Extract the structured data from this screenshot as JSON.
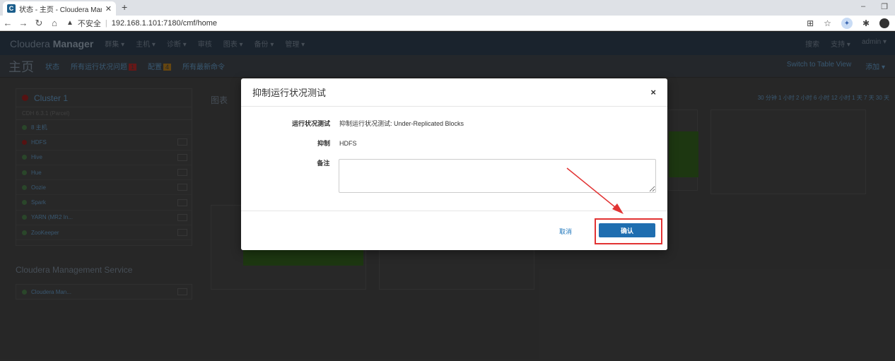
{
  "browser": {
    "tab_title": "状态 - 主页 - Cloudera Manage",
    "tab_favicon": "C",
    "url_warning": "不安全",
    "url": "192.168.1.101:7180/cmf/home"
  },
  "app": {
    "brand_light": "Cloudera",
    "brand_bold": "Manager",
    "nav_items": [
      "群集 ▾",
      "主机 ▾",
      "诊断 ▾",
      "审核",
      "图表 ▾",
      "备份 ▾",
      "管理 ▾"
    ],
    "nav_right": [
      "搜索",
      "支持 ▾",
      "admin ▾"
    ],
    "page_title": "主页",
    "subtabs": [
      "状态",
      "所有运行状况问题",
      "配置",
      "所有最新命令"
    ],
    "health_badge": "1",
    "config_badge": "4",
    "subbar_right": [
      "Switch to Table View",
      "添加 ▾"
    ],
    "cluster_name": "Cluster 1",
    "cdh_version": "CDH 6.3.1 (Parcel)",
    "services": [
      "8 主机",
      "HDFS",
      "Hive",
      "Hue",
      "Oozie",
      "Spark",
      "YARN (MR2 In...",
      "ZooKeeper"
    ],
    "mgmt_title": "Cloudera Management Service",
    "mgmt_service": "Cloudera Man...",
    "charts_label": "图表",
    "time_range": "30 分钟  1 小时  2 小时  6 小时  12 小时  1 天  7 天  30 天"
  },
  "modal": {
    "title": "抑制运行状况测试",
    "close": "×",
    "test_label": "运行状况测试",
    "test_value": "抑制运行状况测试: Under-Replicated Blocks",
    "suppress_label": "抑制",
    "suppress_value": "HDFS",
    "notes_label": "备注",
    "notes_value": "",
    "cancel_label": "取消",
    "confirm_label": "确认"
  },
  "colors": {
    "confirm": "#1f6eb0",
    "highlight": "#e23333"
  }
}
